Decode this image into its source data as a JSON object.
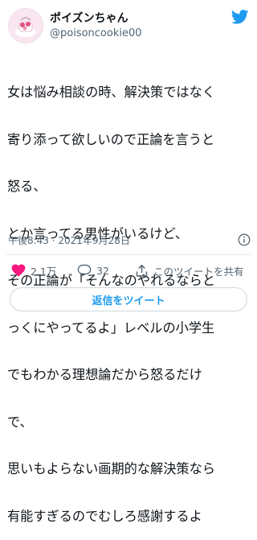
{
  "user": {
    "display_name": "ポイズンちゃん",
    "handle": "@poisoncookie00"
  },
  "tweet": {
    "lines": [
      "女は悩み相談の時、解決策ではなく",
      "寄り添って欲しいので正論を言うと",
      "怒る、",
      "とか言ってる男性がいるけど、",
      "その正論が「そんなのやれるならと",
      "っくにやってるよ」レベルの小学生",
      "でもわかる理想論だから怒るだけ",
      "で、",
      "思いもよらない画期的な解決策なら",
      "有能すぎるのでむしろ感謝するよ"
    ],
    "timestamp": "午後8:43 · 2021年9月28日"
  },
  "actions": {
    "likes": "2.1万",
    "replies": "32",
    "share_label": "このツイートを共有"
  },
  "reply_button_label": "返信をツイート",
  "colors": {
    "twitter_blue": "#1d9bf0",
    "like_red": "#f91880",
    "secondary_text": "#536471"
  },
  "icons": [
    "twitter-bird-icon",
    "info-icon",
    "heart-icon",
    "reply-bubble-icon",
    "share-icon"
  ]
}
